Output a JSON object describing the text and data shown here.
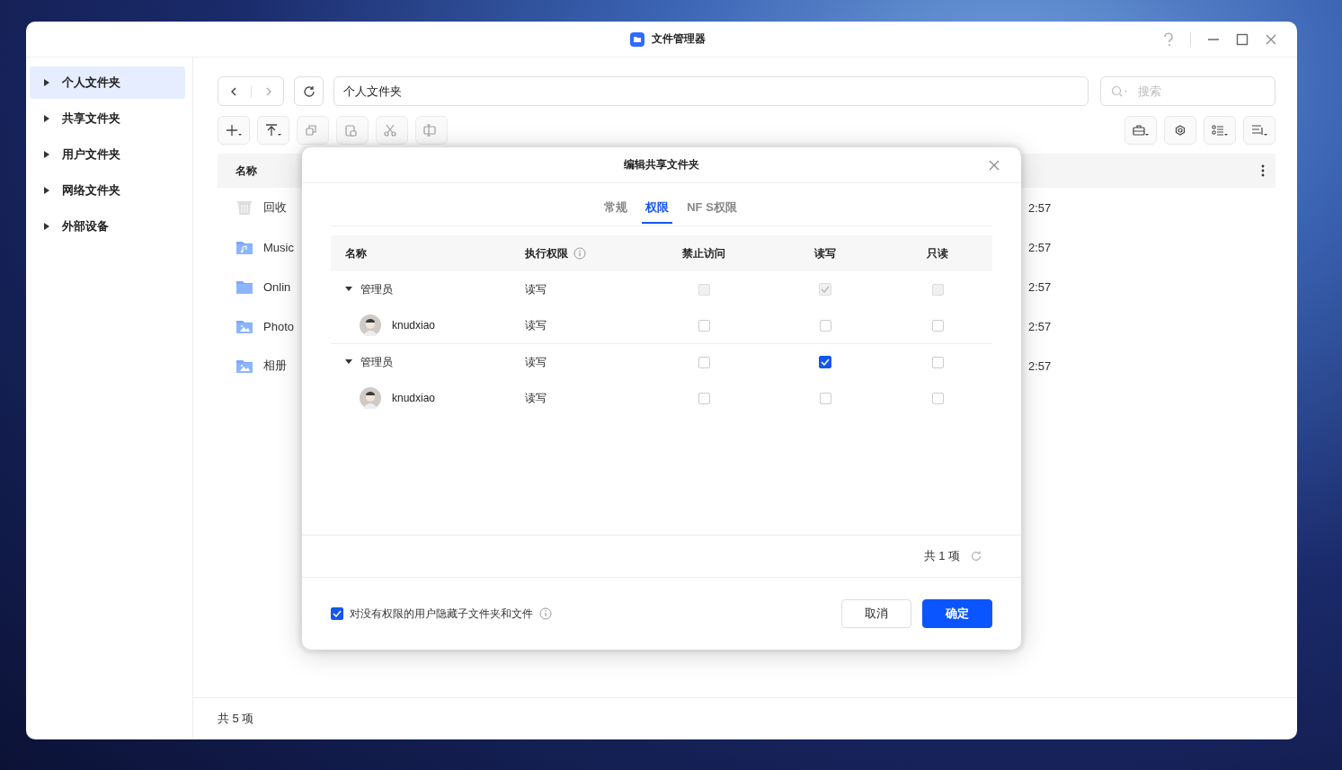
{
  "window": {
    "title": "文件管理器"
  },
  "sidebar": {
    "items": [
      {
        "label": "个人文件夹",
        "selected": true
      },
      {
        "label": "共享文件夹",
        "selected": false
      },
      {
        "label": "用户文件夹",
        "selected": false
      },
      {
        "label": "网络文件夹",
        "selected": false
      },
      {
        "label": "外部设备",
        "selected": false
      }
    ]
  },
  "path_field": {
    "value": "个人文件夹"
  },
  "search": {
    "placeholder": "搜索"
  },
  "file_list": {
    "columns": [
      "名称"
    ],
    "rows": [
      {
        "name": "回收",
        "kind": "trash",
        "time": "2:57"
      },
      {
        "name": "Music",
        "kind": "music",
        "time": "2:57"
      },
      {
        "name": "Onlin",
        "kind": "folder",
        "time": "2:57"
      },
      {
        "name": "Photo",
        "kind": "photo",
        "time": "2:57"
      },
      {
        "name": "相册",
        "kind": "photo",
        "time": "2:57"
      }
    ]
  },
  "status_bar": {
    "count": "共 5 项"
  },
  "dialog": {
    "title": "编辑共享文件夹",
    "tabs": [
      {
        "label": "常规",
        "selected": false
      },
      {
        "label": "权限",
        "selected": true
      },
      {
        "label": "NF S权限",
        "selected": false
      }
    ],
    "columns": [
      "名称",
      "执行权限",
      "禁止访问",
      "读写",
      "只读"
    ],
    "groups": [
      {
        "name": "管理员",
        "expanded": true,
        "permission": "读写",
        "cells": [
          {
            "checked": false,
            "disabled": true
          },
          {
            "checked": true,
            "disabled": true
          },
          {
            "checked": false,
            "disabled": true
          }
        ],
        "children": [
          {
            "name": "knudxiao",
            "permission": "读写",
            "cells": [
              {
                "checked": false,
                "disabled": false
              },
              {
                "checked": false,
                "disabled": false
              },
              {
                "checked": false,
                "disabled": false
              }
            ]
          }
        ]
      },
      {
        "name": "管理员",
        "expanded": true,
        "permission": "读写",
        "cells": [
          {
            "checked": false,
            "disabled": false
          },
          {
            "checked": true,
            "disabled": false
          },
          {
            "checked": false,
            "disabled": false
          }
        ],
        "children": [
          {
            "name": "knudxiao",
            "permission": "读写",
            "cells": [
              {
                "checked": false,
                "disabled": false
              },
              {
                "checked": false,
                "disabled": false
              },
              {
                "checked": false,
                "disabled": false
              }
            ]
          }
        ]
      }
    ],
    "count": "共 1 项",
    "hide_option": {
      "label": "对没有权限的用户隐藏子文件夹和文件",
      "checked": true
    },
    "buttons": [
      {
        "label": "取消",
        "kind": "secondary"
      },
      {
        "label": "确定",
        "kind": "primary"
      }
    ]
  }
}
